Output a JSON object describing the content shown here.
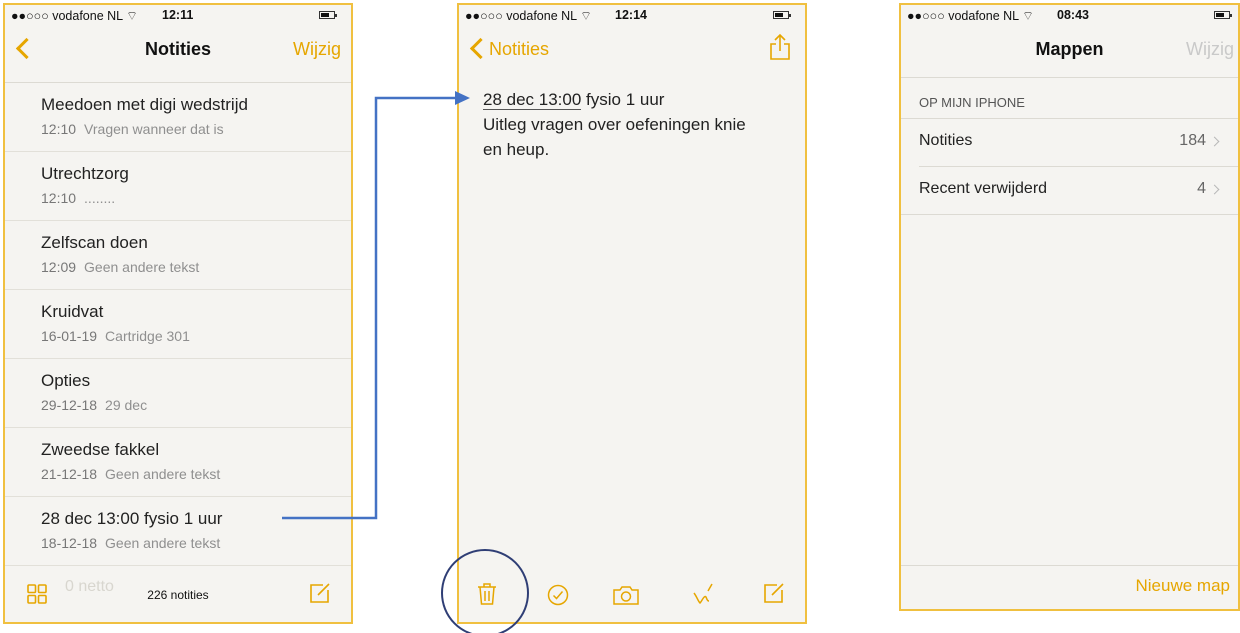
{
  "colors": {
    "accent": "#e6a600",
    "frame": "#f0c040",
    "arrow": "#4472c4",
    "paper": "#f5f4f1"
  },
  "phone1": {
    "status": {
      "carrier": "●●○○○ vodafone NL ⌔",
      "time": "12:11"
    },
    "nav": {
      "title": "Notities",
      "edit": "Wijzig"
    },
    "notes": [
      {
        "title": "Meedoen met digi wedstrijd",
        "date": "12:10",
        "preview": "Vragen wanneer dat is"
      },
      {
        "title": "Utrechtzorg",
        "date": "12:10",
        "preview": "........"
      },
      {
        "title": "Zelfscan doen",
        "date": "12:09",
        "preview": "Geen andere tekst"
      },
      {
        "title": "Kruidvat",
        "date": "16-01-19",
        "preview": "Cartridge 301"
      },
      {
        "title": "Opties",
        "date": "29-12-18",
        "preview": "29 dec"
      },
      {
        "title": "Zweedse fakkel",
        "date": "21-12-18",
        "preview": "Geen andere tekst"
      },
      {
        "title": "28 dec 13:00 fysio 1 uur",
        "date": "18-12-18",
        "preview": "Geen andere tekst"
      }
    ],
    "toolbar": {
      "count": "226 notities",
      "ghost_text": "0 netto"
    }
  },
  "phone2": {
    "status": {
      "carrier": "●●○○○ vodafone NL ⌔",
      "time": "12:14"
    },
    "nav": {
      "back": "Notities"
    },
    "note": {
      "line1_date": "28 dec 13:00",
      "line1_rest": " fysio 1 uur",
      "line2": "Uitleg vragen over oefeningen knie",
      "line3": "en heup."
    },
    "toolbar": {
      "icons": [
        "trash-icon",
        "checklist-icon",
        "camera-icon",
        "sketch-icon",
        "compose-icon"
      ]
    }
  },
  "phone3": {
    "status": {
      "carrier": "●●○○○ vodafone NL ⌔",
      "time": "08:43"
    },
    "nav": {
      "title": "Mappen",
      "edit": "Wijzig"
    },
    "section": "OP MIJN IPHONE",
    "folders": [
      {
        "name": "Notities",
        "count": "184"
      },
      {
        "name": "Recent verwijderd",
        "count": "4"
      }
    ],
    "new_folder": "Nieuwe map"
  }
}
